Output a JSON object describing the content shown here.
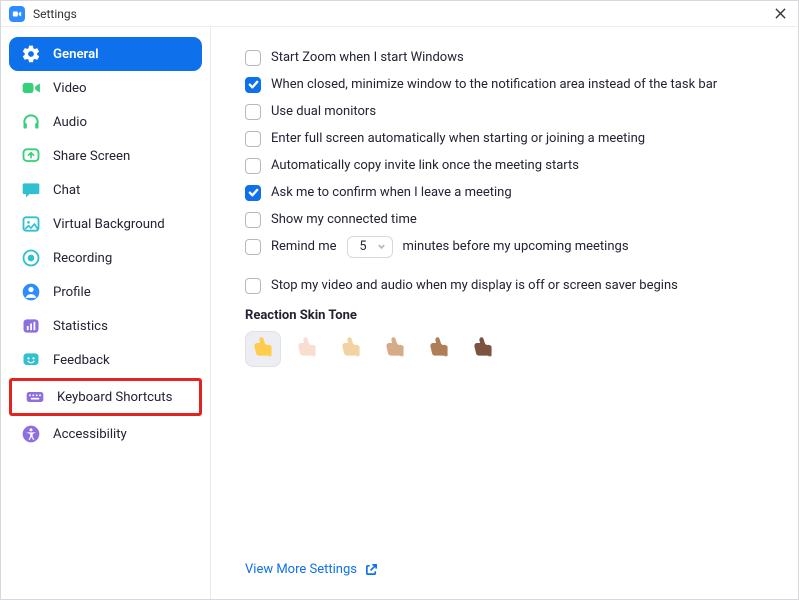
{
  "window": {
    "title": "Settings"
  },
  "sidebar": {
    "items": [
      {
        "label": "General"
      },
      {
        "label": "Video"
      },
      {
        "label": "Audio"
      },
      {
        "label": "Share Screen"
      },
      {
        "label": "Chat"
      },
      {
        "label": "Virtual Background"
      },
      {
        "label": "Recording"
      },
      {
        "label": "Profile"
      },
      {
        "label": "Statistics"
      },
      {
        "label": "Feedback"
      },
      {
        "label": "Keyboard Shortcuts"
      },
      {
        "label": "Accessibility"
      }
    ]
  },
  "options": {
    "start_with_windows": "Start Zoom when I start Windows",
    "minimize_to_tray": "When closed, minimize window to the notification area instead of the task bar",
    "dual_monitors": "Use dual monitors",
    "full_screen_auto": "Enter full screen automatically when starting or joining a meeting",
    "copy_invite": "Automatically copy invite link once the meeting starts",
    "confirm_leave": "Ask me to confirm when I leave a meeting",
    "show_connected_time": "Show my connected time",
    "remind_prefix": "Remind me",
    "remind_value": "5",
    "remind_suffix": "minutes before my upcoming meetings",
    "stop_video_audio": "Stop my video and audio when my display is off or screen saver begins"
  },
  "reaction": {
    "title": "Reaction Skin Tone",
    "tones": [
      "#ffcc4d",
      "#f7dece",
      "#f3d2a2",
      "#d5ab88",
      "#af7e57",
      "#7c533e"
    ]
  },
  "footer": {
    "view_more": "View More Settings"
  }
}
